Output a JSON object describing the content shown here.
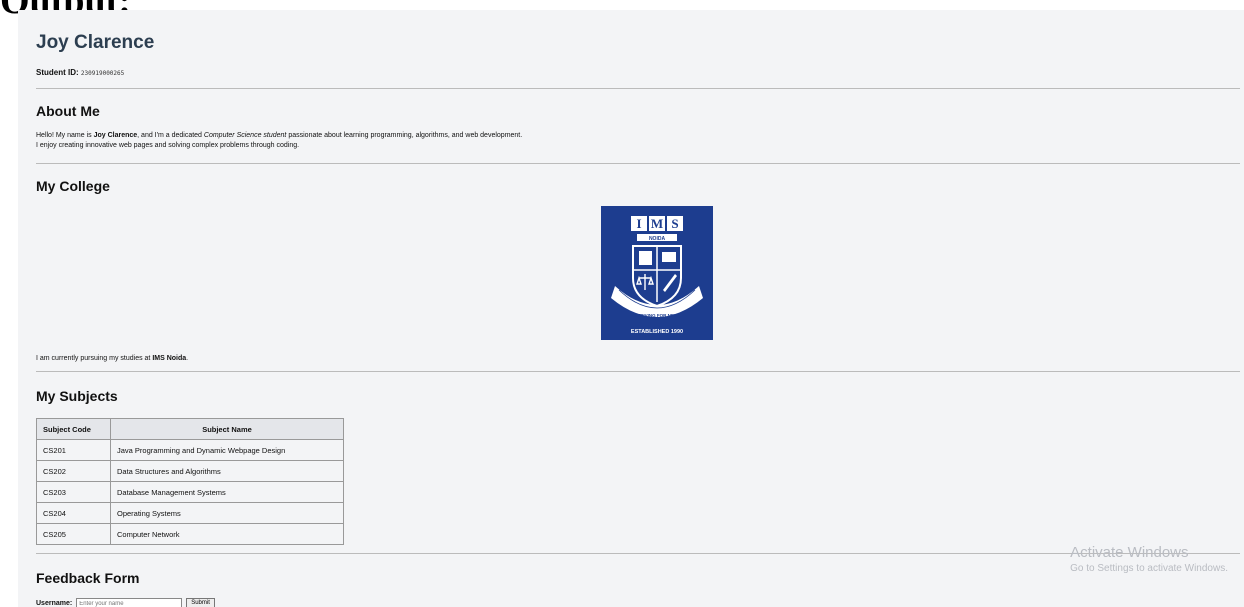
{
  "caption": "Output:",
  "profile": {
    "name": "Joy Clarence",
    "student_id_label": "Student ID:",
    "student_id_value": "230919000265"
  },
  "about": {
    "heading": "About Me",
    "line1_part1": "Hello! My name is ",
    "line1_name": "Joy Clarence",
    "line1_part2": ", and I'm a dedicated ",
    "line1_italic": "Computer Science student",
    "line1_part3": " passionate about learning programming, algorithms, and web development.",
    "line2": "I enjoy creating innovative web pages and solving complex problems through coding."
  },
  "college": {
    "heading": "My College",
    "logo_text_top": "IMS",
    "logo_text_sub": "NOIDA",
    "logo_motto": "STRIVING FOR NEXT",
    "logo_established": "ESTABLISHED 1990",
    "text_part1": "I am currently pursuing my studies at ",
    "text_bold": "IMS Noida",
    "text_part2": "."
  },
  "subjects": {
    "heading": "My Subjects",
    "columns": [
      "Subject Code",
      "Subject Name"
    ],
    "rows": [
      [
        "CS201",
        "Java Programming and Dynamic Webpage Design"
      ],
      [
        "CS202",
        "Data Structures and Algorithms"
      ],
      [
        "CS203",
        "Database Management Systems"
      ],
      [
        "CS204",
        "Operating Systems"
      ],
      [
        "CS205",
        "Computer Network"
      ]
    ]
  },
  "feedback": {
    "heading": "Feedback Form",
    "username_label": "Username:",
    "username_placeholder": "Enter your name",
    "submit_label": "Submit"
  },
  "watermark": {
    "line1": "Activate Windows",
    "line2": "Go to Settings to activate Windows."
  },
  "colors": {
    "page_bg": "#f3f4f6",
    "name_color": "#2c3e50",
    "logo_blue": "#1d3d8f"
  }
}
